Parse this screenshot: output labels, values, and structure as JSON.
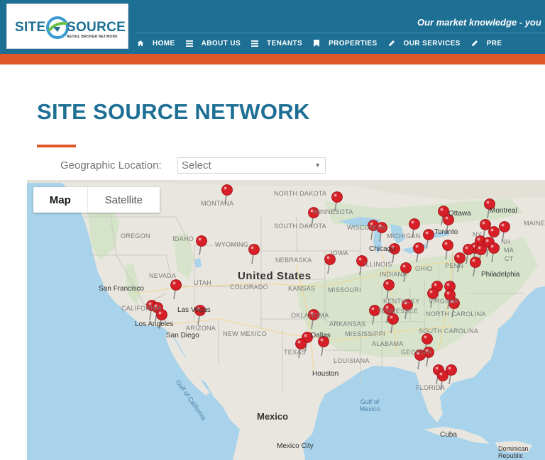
{
  "header": {
    "logo_site": "SITE",
    "logo_source": "SOURCE",
    "logo_sub": "RETAIL BROKER NETWORK",
    "tagline": "Our market knowledge - you",
    "background_color": "#1d6f94",
    "accent_color": "#e0582a"
  },
  "nav": [
    {
      "icon": "home-icon",
      "label": "HOME"
    },
    {
      "icon": "menu-icon",
      "label": "ABOUT US"
    },
    {
      "icon": "menu-icon",
      "label": "TENANTS"
    },
    {
      "icon": "bookmark-icon",
      "label": "PROPERTIES"
    },
    {
      "icon": "pencil-icon",
      "label": "OUR SERVICES"
    },
    {
      "icon": "pencil-icon",
      "label": "PRE"
    }
  ],
  "page": {
    "title": "SITE SOURCE NETWORK",
    "geo_label": "Geographic Location:",
    "geo_select_value": "Select"
  },
  "map": {
    "toggle_map": "Map",
    "toggle_satellite": "Satellite",
    "country_label": "United States",
    "states": [
      "NORTH DAKOTA",
      "MONTANA",
      "SOUTH DAKOTA",
      "MINNESOTA",
      "OREGON",
      "IDAHO",
      "WYOMING",
      "NEBRASKA",
      "IOWA",
      "WISCONSIN",
      "MICHIGAN",
      "NEVADA",
      "UTAH",
      "COLORADO",
      "KANSAS",
      "MISSOURI",
      "ILLINOIS",
      "INDIANA",
      "OHIO",
      "CALIFORNIA",
      "ARIZONA",
      "NEW MEXICO",
      "OKLAHOMA",
      "ARKANSAS",
      "MISSISSIPPI",
      "ALABAMA",
      "GEORGIA",
      "TEXAS",
      "LOUISIANA",
      "FLORIDA",
      "KENTUCKY",
      "TENNESSEE",
      "VIRGINIA",
      "NORTH CAROLINA",
      "SOUTH CAROLINA",
      "PENN",
      "NY",
      "MAINE",
      "NH",
      "MA",
      "CT"
    ],
    "cities": [
      "San Francisco",
      "Las Vegas",
      "Los Angeles",
      "San Diego",
      "Chicago",
      "Toronto",
      "Ottawa",
      "Montreal",
      "Philadelphia",
      "Dallas",
      "Houston",
      "Mexico City"
    ],
    "countries": [
      "Mexico",
      "Cuba",
      "Dominican Republic"
    ],
    "waters": [
      "Gulf of California",
      "Gulf of Mexico"
    ],
    "marker_count": 54,
    "marker_color": "#d61f26"
  }
}
